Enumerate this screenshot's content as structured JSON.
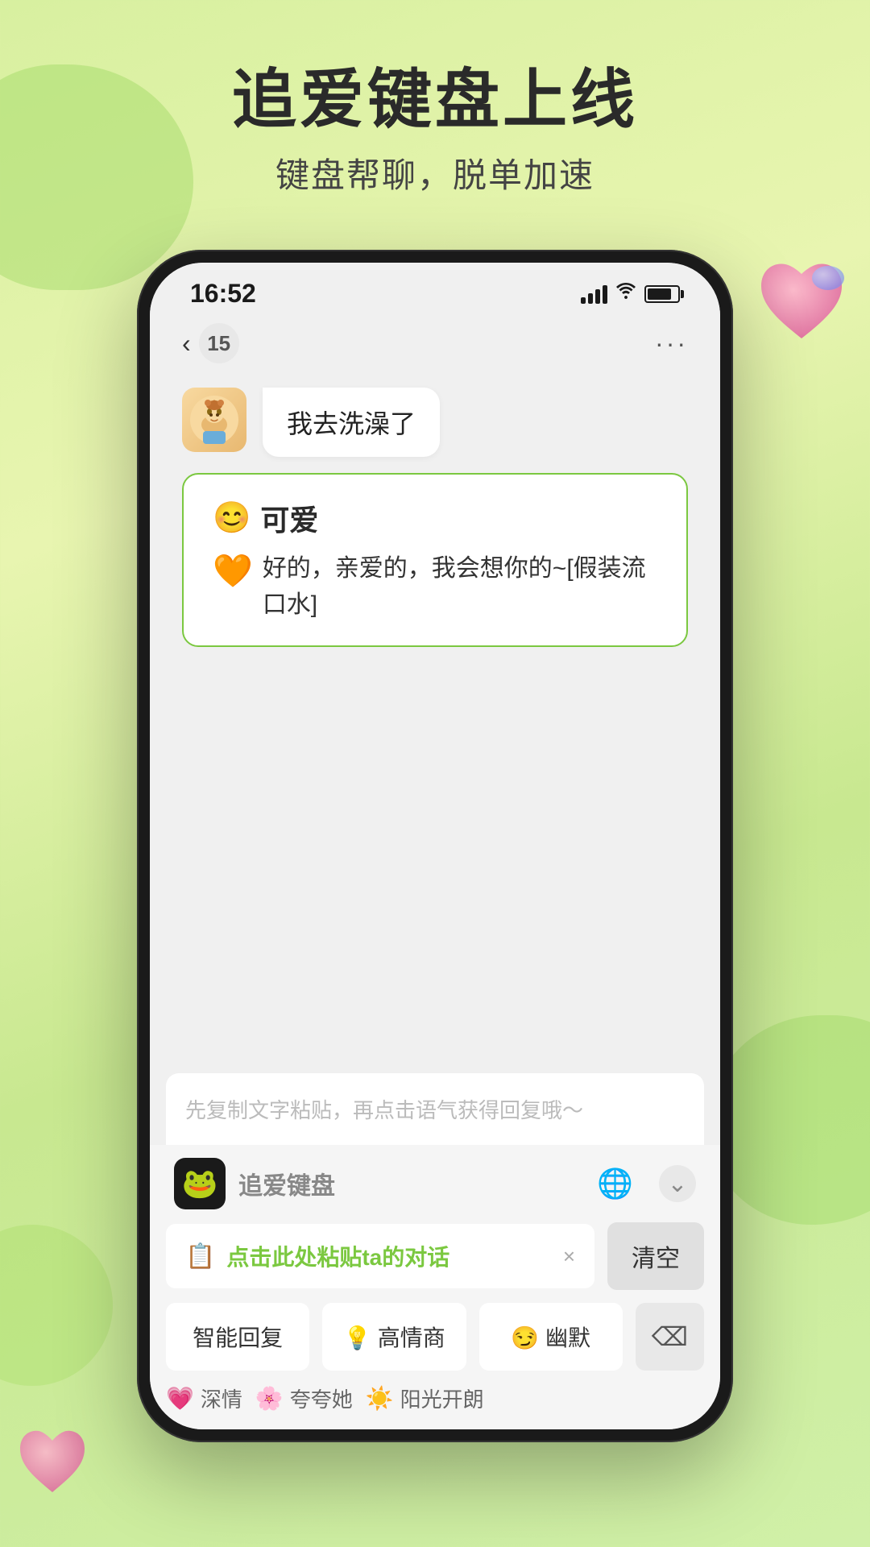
{
  "background": {
    "color": "#d8f0a0"
  },
  "header": {
    "main_title": "追爱键盘上线",
    "sub_title": "键盘帮聊，脱单加速"
  },
  "status_bar": {
    "time": "16:52",
    "signal_label": "signal",
    "wifi_label": "wifi",
    "battery_label": "battery"
  },
  "nav_bar": {
    "back_label": "‹",
    "badge_count": "15",
    "more_label": "···"
  },
  "chat": {
    "received_message": "我去洗澡了",
    "suggestion_header_emoji": "😊",
    "suggestion_header_text": "可爱",
    "suggestion_body_icon": "🧡",
    "suggestion_body_text": "好的，亲爱的，我会想你的~[假装流口水]"
  },
  "keyboard": {
    "input_placeholder": "先复制文字粘贴，再点击语气获得回复哦～",
    "brand_name": "追爱键盘",
    "globe_icon": "🌐",
    "chevron_icon": "⌄",
    "paste_icon": "📋",
    "paste_text": "点击此处粘贴ta的对话",
    "paste_close": "×",
    "clear_label": "清空",
    "btn1_label": "智能回复",
    "btn2_emoji": "💡",
    "btn2_label": "高情商",
    "btn3_emoji": "😏",
    "btn3_label": "幽默",
    "backspace_icon": "⌫",
    "tag1_emoji": "💗",
    "tag1_label": "深情",
    "tag2_emoji": "🌸",
    "tag2_label": "夸夸她",
    "tag3_emoji": "☀️",
    "tag3_label": "阳光开朗"
  }
}
